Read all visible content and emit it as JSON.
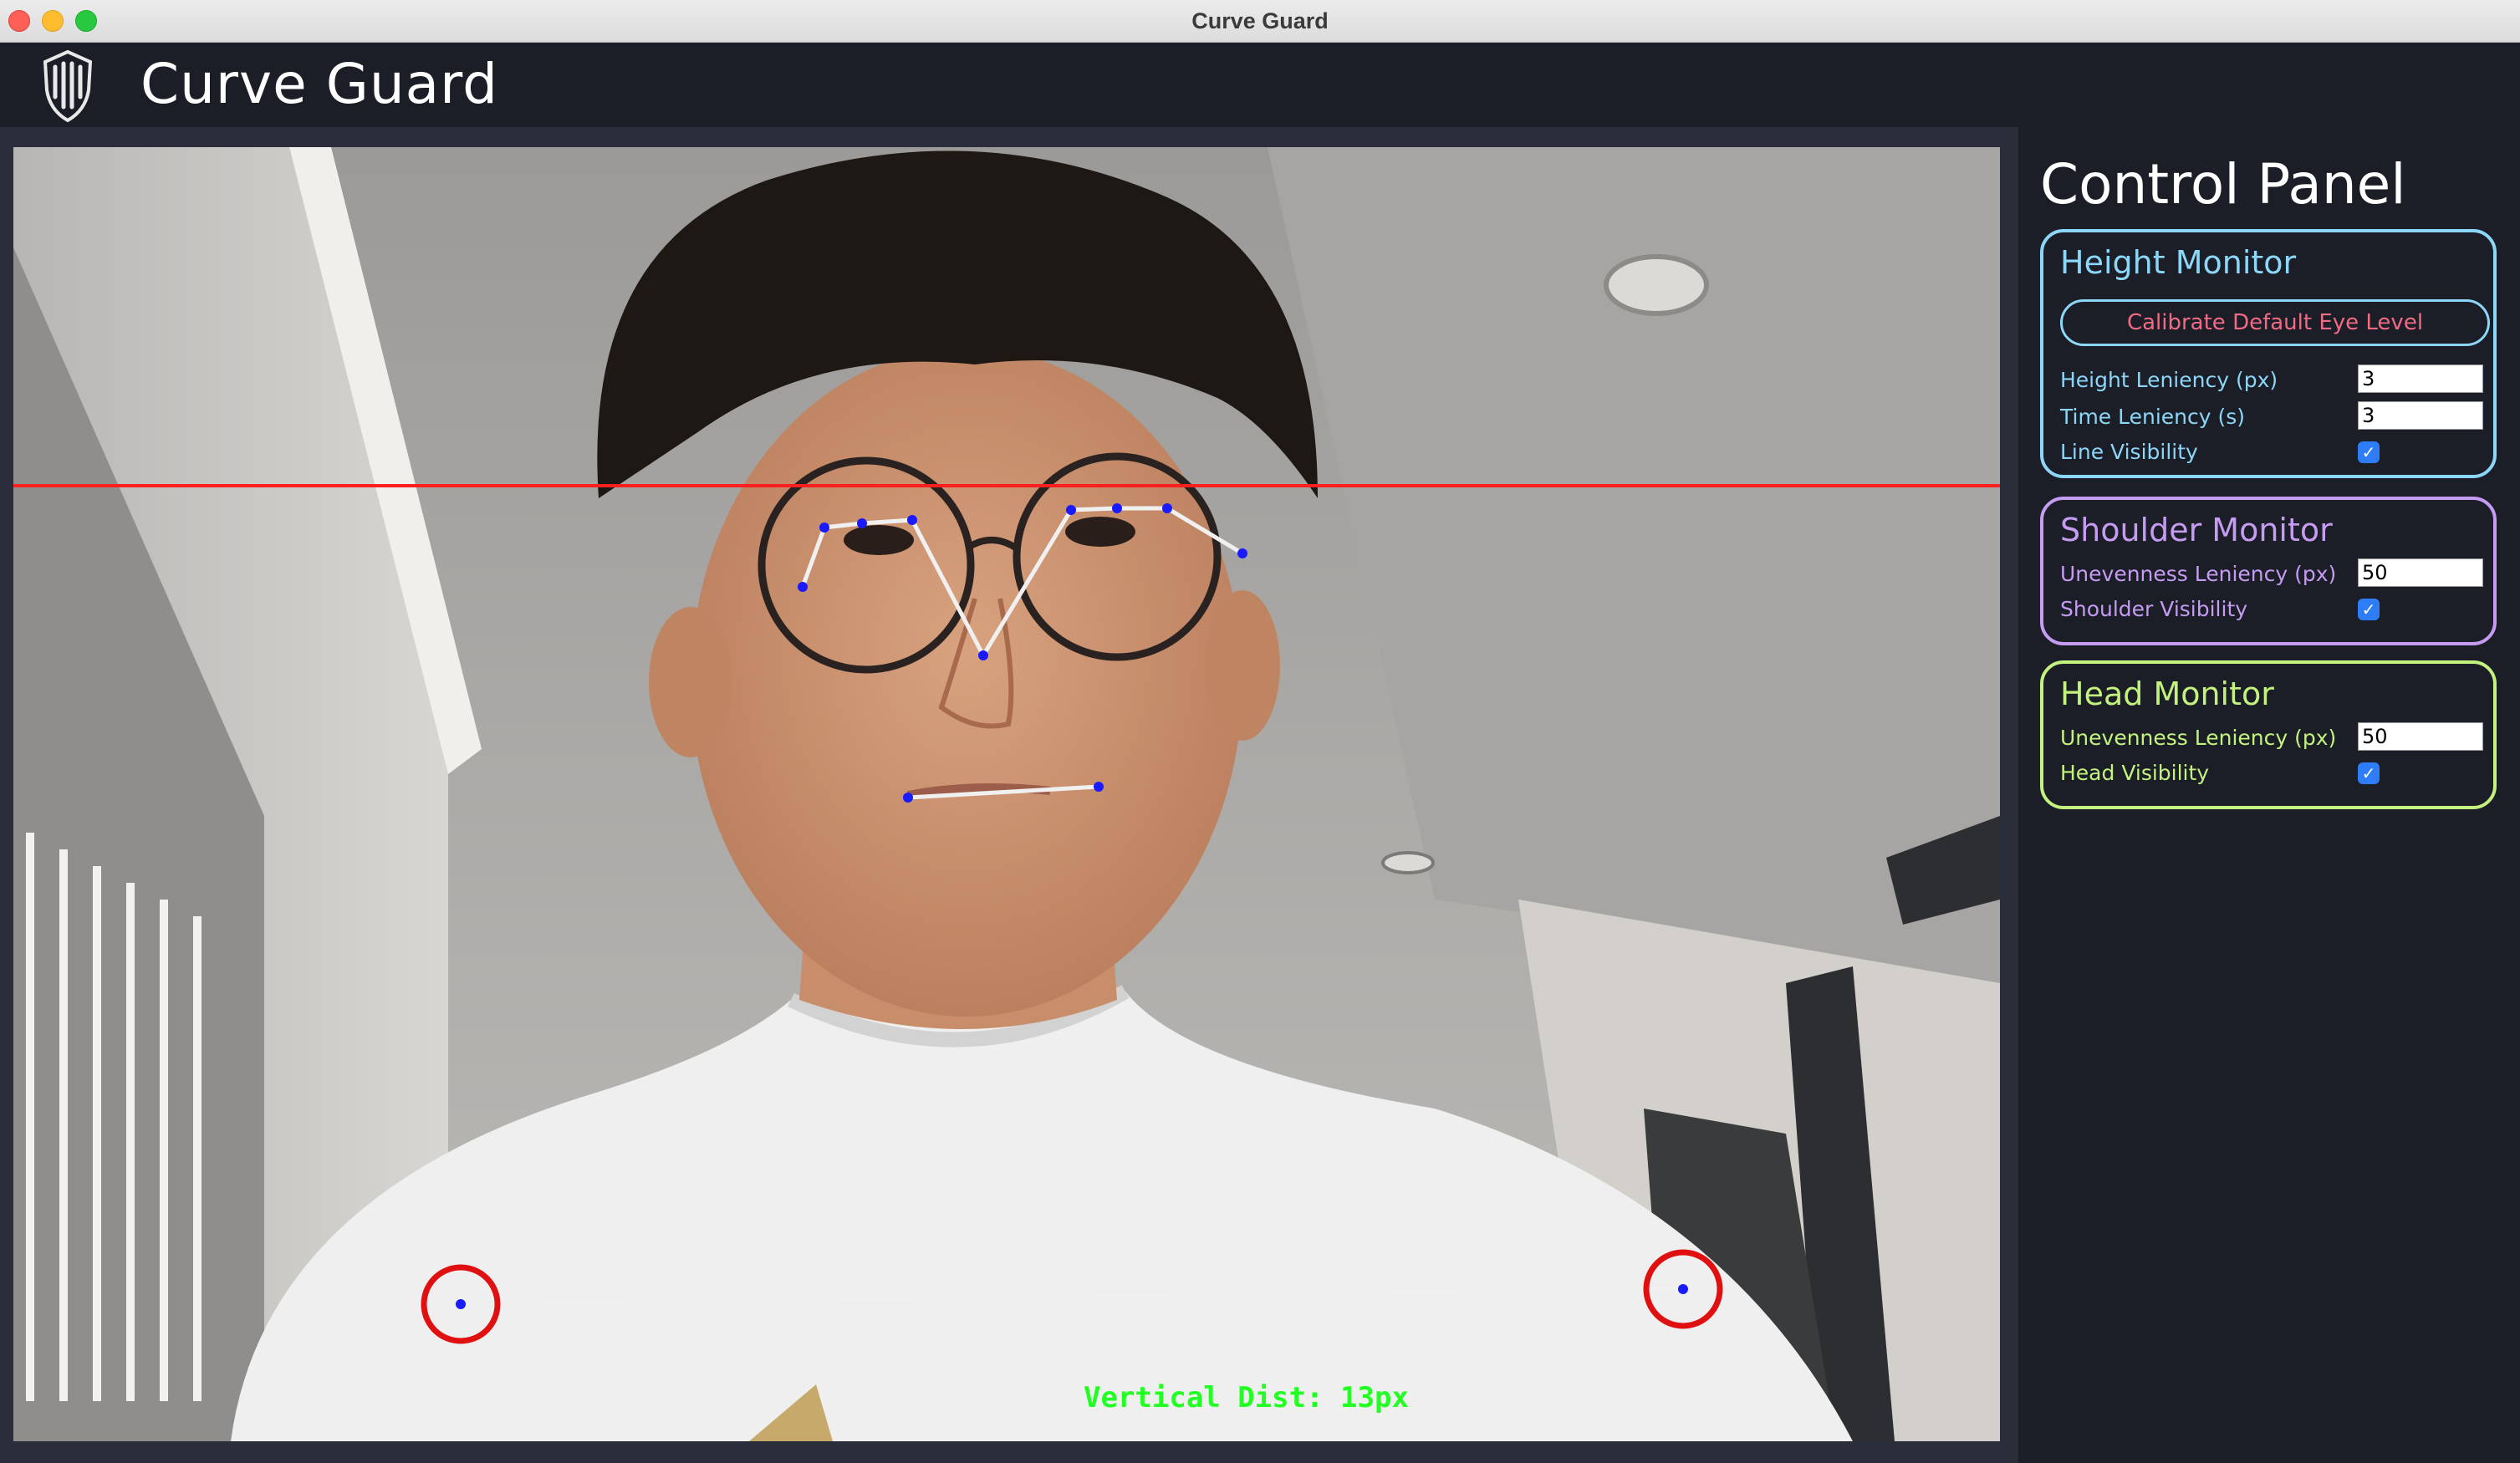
{
  "window": {
    "title": "Curve Guard"
  },
  "header": {
    "app_title": "Curve Guard",
    "logo_icon": "shield-logo-icon"
  },
  "feed": {
    "overlay_text": "Vertical Dist: 13px",
    "colors": {
      "eye_level_line": "#ff1f1f",
      "landmarks": "#1a1aff",
      "connectors": "#f0f0f0",
      "shoulder_circles": "#e01010",
      "distance_text": "#22ff22"
    }
  },
  "panel": {
    "title": "Control Panel",
    "height_monitor": {
      "title": "Height Monitor",
      "color": "#8cd6f7",
      "calibrate_label": "Calibrate Default Eye Level",
      "height_leniency_label": "Height Leniency (px)",
      "height_leniency_value": "3",
      "time_leniency_label": "Time Leniency (s)",
      "time_leniency_value": "3",
      "line_visibility_label": "Line Visibility",
      "line_visibility_checked": true
    },
    "shoulder_monitor": {
      "title": "Shoulder Monitor",
      "color": "#c59cf2",
      "unevenness_label": "Unevenness Leniency (px)",
      "unevenness_value": "50",
      "visibility_label": "Shoulder Visibility",
      "visibility_checked": true
    },
    "head_monitor": {
      "title": "Head Monitor",
      "color": "#c3f27e",
      "unevenness_label": "Unevenness Leniency (px)",
      "unevenness_value": "50",
      "visibility_label": "Head Visibility",
      "visibility_checked": true
    }
  }
}
